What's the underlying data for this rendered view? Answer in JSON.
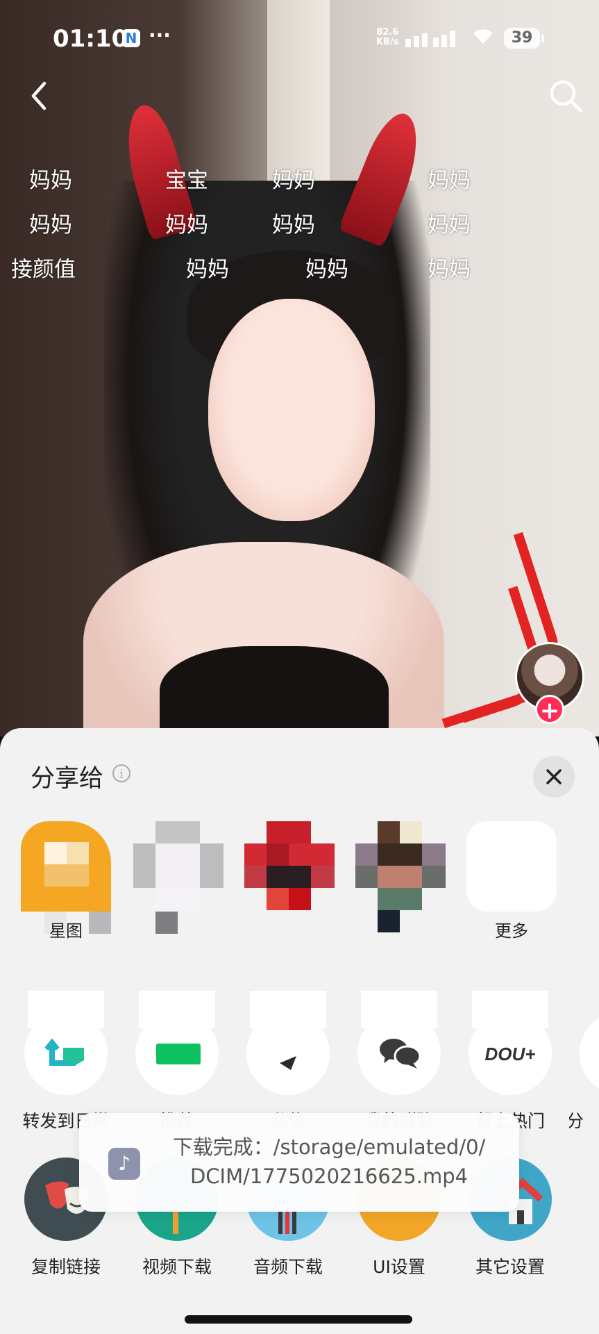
{
  "status_bar": {
    "time": "01:10",
    "app_badge": "N",
    "more": "···",
    "speed_value": "82.6",
    "speed_unit": "KB/s",
    "battery": "39"
  },
  "video": {
    "danmaku": [
      "妈妈",
      "宝宝",
      "妈妈",
      "妈妈",
      "妈妈",
      "妈妈",
      "妈妈",
      "妈妈",
      "接颜值",
      "妈妈",
      "妈妈",
      "妈妈"
    ]
  },
  "creator": {
    "follow_symbol": "+"
  },
  "share_sheet": {
    "title": "分享给",
    "info_symbol": "i",
    "contacts": [
      {
        "name": "星图"
      },
      {
        "name": ""
      },
      {
        "name": ""
      },
      {
        "name": ""
      },
      {
        "name": "更多"
      }
    ],
    "actions_row1": [
      {
        "label": "转发到日常",
        "icon": "repost-icon"
      },
      {
        "label": "推荐",
        "icon": "recommend-icon"
      },
      {
        "label": "私信",
        "icon": "message-icon"
      },
      {
        "label": "我的群聊",
        "icon": "group-chat-icon"
      },
      {
        "label": "帮上热门",
        "icon": "dou-plus-icon",
        "icon_text": "DOU+"
      },
      {
        "label": "分",
        "icon": "share-icon"
      }
    ],
    "actions_row2": [
      {
        "label": "复制链接",
        "icon": "drama-mask-icon"
      },
      {
        "label": "视频下载",
        "icon": "video-download-icon"
      },
      {
        "label": "音频下载",
        "icon": "audio-download-icon"
      },
      {
        "label": "UI设置",
        "icon": "ui-settings-icon"
      },
      {
        "label": "其它设置",
        "icon": "home-settings-icon"
      }
    ]
  },
  "toast": {
    "line1": "下载完成：/storage/emulated/0/",
    "line2": "DCIM/1775020216625.mp4",
    "icon_symbol": "♪"
  },
  "colors": {
    "accent": "#ff2c55",
    "sheet_bg": "#f2f2f2"
  }
}
